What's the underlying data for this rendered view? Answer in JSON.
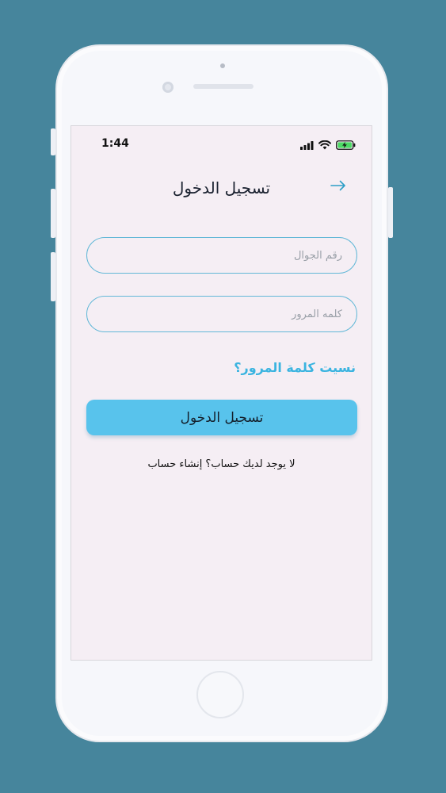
{
  "status_bar": {
    "time": "1:44",
    "icons": [
      "signal-icon",
      "wifi-icon",
      "battery-charging-icon"
    ]
  },
  "header": {
    "title": "تسجيل الدخول",
    "back_icon": "arrow-right-icon"
  },
  "form": {
    "phone_placeholder": "رقم الجوال",
    "password_placeholder": "كلمه المرور",
    "forgot_password": "نسيت كلمة المرور؟",
    "login_button": "تسجيل الدخول",
    "signup_prompt": "لا يوجد لديك حساب؟ إنشاء حساب"
  },
  "colors": {
    "background": "#46859c",
    "screen": "#f5eef4",
    "accent": "#58c3ec",
    "link": "#3bb4e0",
    "field_border": "#63b8d7"
  }
}
